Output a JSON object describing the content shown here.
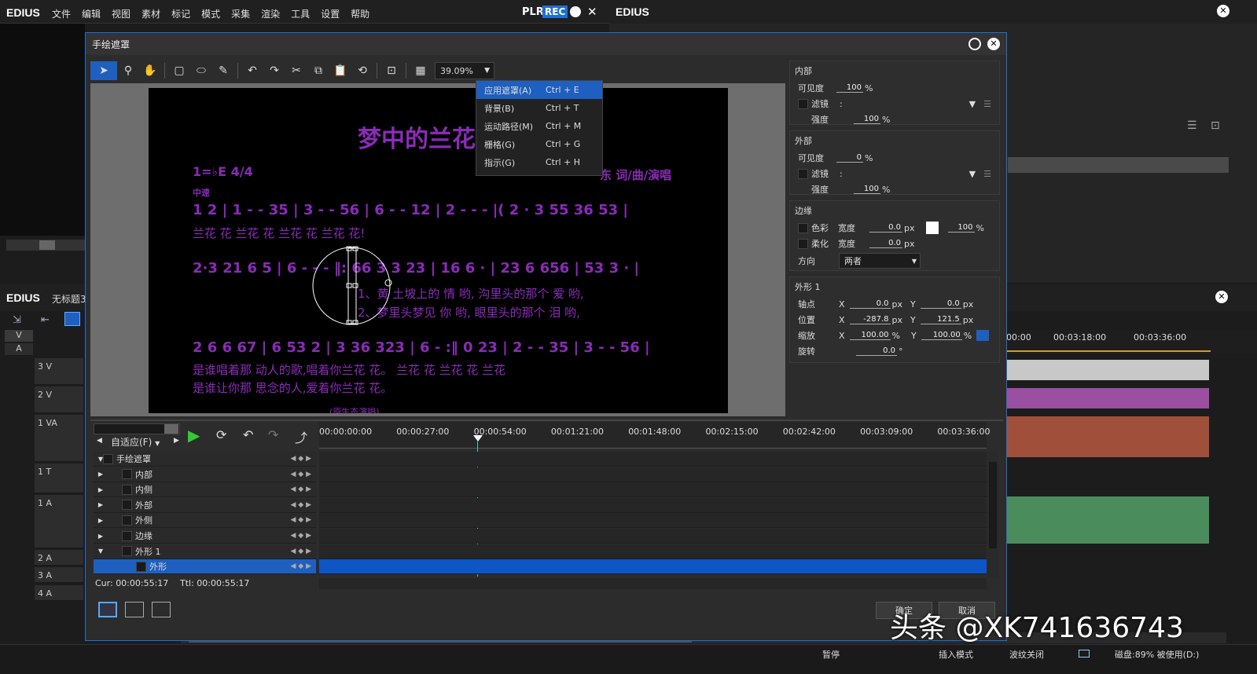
{
  "main": {
    "logo": "EDIUS",
    "menu": [
      "文件",
      "编辑",
      "视图",
      "素材",
      "标记",
      "模式",
      "采集",
      "渲染",
      "工具",
      "设置",
      "帮助"
    ],
    "plr": "PLR",
    "rec": "REC",
    "right_logo": "EDIUS",
    "timeline_logo": "EDIUS",
    "timeline_title": "无标题3"
  },
  "tracks": [
    {
      "label": "3 V",
      "color": "#c8c8c8"
    },
    {
      "label": "2 V",
      "color": "#9a4fa0"
    },
    {
      "label": "1 VA",
      "color": "#a0503a"
    },
    {
      "label": "1 T",
      "color": ""
    },
    {
      "label": "1 A",
      "color": "#4a8c5c"
    },
    {
      "label": "2 A",
      "color": ""
    },
    {
      "label": "3 A",
      "color": ""
    },
    {
      "label": "4 A",
      "color": ""
    }
  ],
  "track_headers": {
    "v": "V",
    "a": "A"
  },
  "bg_ruler": [
    "00:00",
    "00:03:18:00",
    "00:03:36:00"
  ],
  "dialog": {
    "title": "手绘遮罩",
    "zoom": "39.09%",
    "menu": [
      {
        "label": "应用遮罩(A)",
        "shortcut": "Ctrl + E"
      },
      {
        "label": "背景(B)",
        "shortcut": "Ctrl + T"
      },
      {
        "label": "运动路径(M)",
        "shortcut": "Ctrl + M"
      },
      {
        "label": "栅格(G)",
        "shortcut": "Ctrl + G"
      },
      {
        "label": "指示(G)",
        "shortcut": "Ctrl + H"
      }
    ],
    "sheet": {
      "title": "梦中的兰花",
      "credit": "东 词/曲/演唱",
      "key": "1=♭E 4/4",
      "tempo": "中速",
      "line1": "1 2 | 1 - - 35 | 3 - - 56 | 6 - - 12 | 2 - - - |( 2 · 3 55 36 53 |",
      "lyric1": "兰花  花    兰花  花    兰花  花    兰花  花!",
      "line2": "2·3 21 6 5 | 6 - - - ‖: 66 3 3 23 | 16 6 · | 23 6 656 | 53 3 · |",
      "lyric2a": "1、黄   土坡上的  情   哟,   沟里头的那个   爱   哟,",
      "lyric2b": "2、梦里头梦见   你   哟,   眼里头的那个   泪   哟,",
      "line3": "2 6 6 67 | 6 53 2 | 3 36 323 | 6 - :‖ 0 23 | 2 - - 35 | 3 - - 56 |",
      "lyric3a": "是谁唱着那   动人的歌,唱着你兰花    花。     兰花  花     兰花    花     兰花",
      "lyric3b": "是谁让你那   思念的人,爱着你兰花    花。",
      "footer": "(原生态演唱)"
    },
    "props": {
      "inner_title": "内部",
      "visibility_label": "可见度",
      "inner_visibility": "100",
      "pct": "%",
      "filter_label": "滤镜",
      "filter_colon": ":",
      "strength_label": "强度",
      "inner_strength": "100",
      "outer_title": "外部",
      "outer_visibility": "0",
      "outer_strength": "100",
      "edge_title": "边缘",
      "color_label": "色彩",
      "soft_label": "柔化",
      "width_label": "宽度",
      "edge_color_width": "0.0",
      "edge_soft_width": "0.0",
      "px": "px",
      "edge_opacity": "100",
      "direction_label": "方向",
      "direction_value": "两者",
      "shape_title": "外形 1",
      "axis_label": "轴点",
      "pos_label": "位置",
      "scale_label": "缩放",
      "rot_label": "旋转",
      "x": "X",
      "y": "Y",
      "axis_x": "0.0",
      "axis_y": "0.0",
      "pos_x": "-287.8",
      "pos_y": "121.5",
      "scale_x": "100.00",
      "scale_y": "100.00",
      "rot": "0.0",
      "deg": "°"
    },
    "timeline": {
      "fit": "自适应(F)",
      "ruler": [
        "00:00:00:00",
        "00:00:27:00",
        "00:00:54:00",
        "00:01:21:00",
        "00:01:48:00",
        "00:02:15:00",
        "00:02:42:00",
        "00:03:09:00",
        "00:03:36:00"
      ],
      "tree": [
        "手绘遮罩",
        "内部",
        "内侧",
        "外部",
        "外侧",
        "边缘",
        "外形 1",
        "外形"
      ],
      "cur_label": "Cur:",
      "cur": "00:00:55:17",
      "ttl_label": "Ttl:",
      "ttl": "00:00:55:17"
    },
    "ok": "确定",
    "cancel": "取消"
  },
  "status": {
    "pause": "暂停",
    "insert": "插入模式",
    "ripple": "波纹关闭",
    "disk": "磁盘:89% 被使用(D:)"
  },
  "watermark": "头条 @XK741636743"
}
